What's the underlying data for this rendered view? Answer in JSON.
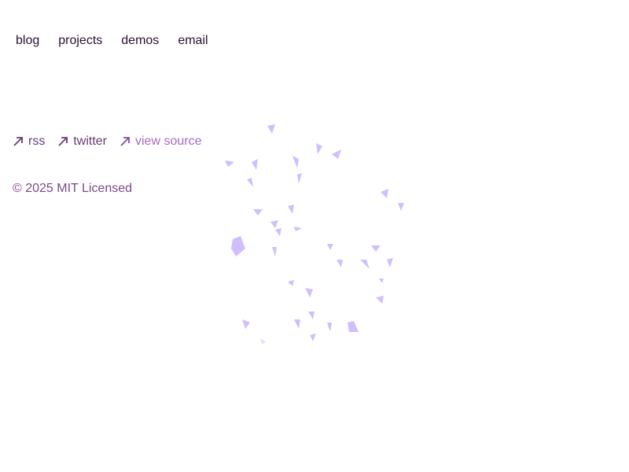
{
  "nav": {
    "items": [
      {
        "label": "blog"
      },
      {
        "label": "projects"
      },
      {
        "label": "demos"
      },
      {
        "label": "email"
      }
    ]
  },
  "footer": {
    "links": [
      {
        "label": "rss",
        "icon": "arrow-up-right-icon"
      },
      {
        "label": "twitter",
        "icon": "arrow-up-right-icon"
      },
      {
        "label": "view source",
        "icon": "arrow-up-right-icon"
      }
    ],
    "copyright": "© 2025 MIT Licensed"
  },
  "colors": {
    "nav_text": "#2b0f33",
    "link_text": "#6a3b78",
    "link_faded": "#a66bc0",
    "copyright_text": "#7a4a8a",
    "confetti": "#c9b3ff"
  }
}
